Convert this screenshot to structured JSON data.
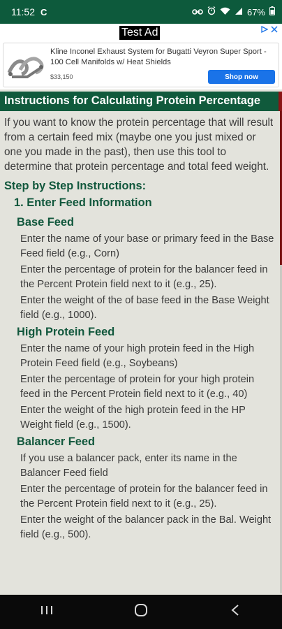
{
  "status_bar": {
    "time": "11:52",
    "app_icon_glyph": "C",
    "battery": "67%",
    "icons": [
      "link-icon",
      "alarm-icon",
      "wifi-icon",
      "signal-icon",
      "battery-icon"
    ]
  },
  "ad": {
    "label": "Test Ad",
    "title": "Kline Inconel Exhaust System for Bugatti Veyron Super Sport - 100 Cell Manifolds w/ Heat Shields",
    "price": "$33,150",
    "button": "Shop now"
  },
  "title": "Instructions for Calculating Protein Percentage",
  "intro": "If you want to know the protein percentage that will result from a certain feed mix (maybe one you just mixed or one you made in the past), then use this tool to determine that protein percentage and total feed weight.",
  "steps_heading": "Step by Step Instructions:",
  "step1_heading": "1. Enter Feed Information",
  "sections": [
    {
      "heading": "Base Feed",
      "paragraphs": [
        "Enter the name of your base or primary feed in the Base Feed field (e.g., Corn)",
        "Enter the percentage of protein for the balancer feed in the Percent Protein field next to it (e.g., 25).",
        "Enter the weight of the of base feed in the Base Weight field (e.g., 1000)."
      ]
    },
    {
      "heading": "High Protein Feed",
      "paragraphs": [
        "Enter the name of your high protein feed in the High Protein Feed field (e.g., Soybeans)",
        "Enter the percentage of protein for your high protein feed in the Percent Protein field next to it (e.g., 40)",
        "Enter the weight of the high protein feed in the HP Weight field (e.g., 1500)."
      ]
    },
    {
      "heading": "Balancer Feed",
      "paragraphs": [
        "If you use a balancer pack, enter its name in the Balancer Feed field",
        "Enter the percentage of protein for the balancer feed in the Percent Protein field next to it (e.g., 25).",
        "Enter the weight of the balancer pack in the Bal. Weight field (e.g., 500)."
      ]
    }
  ],
  "colors": {
    "brand_green": "#105a3c",
    "accent_red": "#8a1515",
    "background": "#e3e3dc"
  }
}
